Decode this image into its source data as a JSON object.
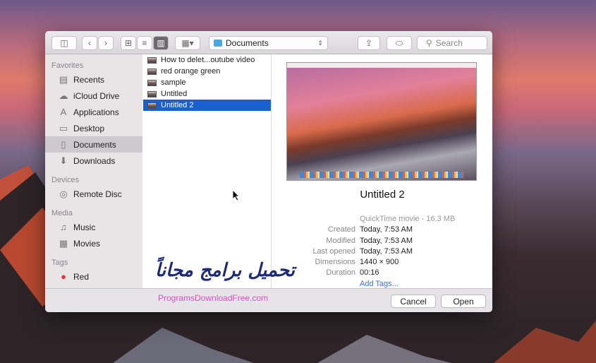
{
  "toolbar": {
    "location": "Documents",
    "search_placeholder": "Search"
  },
  "sidebar": {
    "sections": [
      {
        "title": "Favorites",
        "items": [
          {
            "label": "Recents",
            "icon": "recents-icon",
            "glyph": "▤"
          },
          {
            "label": "iCloud Drive",
            "icon": "cloud-icon",
            "glyph": "☁"
          },
          {
            "label": "Applications",
            "icon": "applications-icon",
            "glyph": "A"
          },
          {
            "label": "Desktop",
            "icon": "desktop-icon",
            "glyph": "▭"
          },
          {
            "label": "Documents",
            "icon": "documents-icon",
            "glyph": "▯",
            "selected": true
          },
          {
            "label": "Downloads",
            "icon": "downloads-icon",
            "glyph": "⬇"
          }
        ]
      },
      {
        "title": "Devices",
        "items": [
          {
            "label": "Remote Disc",
            "icon": "disc-icon",
            "glyph": "◎"
          }
        ]
      },
      {
        "title": "Media",
        "items": [
          {
            "label": "Music",
            "icon": "music-icon",
            "glyph": "♫"
          },
          {
            "label": "Movies",
            "icon": "movies-icon",
            "glyph": "▦"
          }
        ]
      },
      {
        "title": "Tags",
        "items": [
          {
            "label": "Red",
            "icon": "red-tag-icon",
            "glyph": "●",
            "color": "#e8323c"
          }
        ]
      }
    ]
  },
  "files": [
    {
      "name": "How to delet...outube video"
    },
    {
      "name": "red orange green"
    },
    {
      "name": "sample"
    },
    {
      "name": "Untitled"
    },
    {
      "name": "Untitled 2",
      "selected": true
    }
  ],
  "preview": {
    "title": "Untitled 2",
    "kind": "QuickTime movie - 16.3 MB",
    "meta": [
      {
        "k": "Created",
        "v": "Today, 7:53 AM"
      },
      {
        "k": "Modified",
        "v": "Today, 7:53 AM"
      },
      {
        "k": "Last opened",
        "v": "Today, 7:53 AM"
      },
      {
        "k": "Dimensions",
        "v": "1440 × 900"
      },
      {
        "k": "Duration",
        "v": "00:16"
      }
    ],
    "add_tags": "Add Tags..."
  },
  "buttons": {
    "cancel": "Cancel",
    "open": "Open"
  },
  "watermark": {
    "arabic": "تحميل برامج مجاناً",
    "site": "ProgramsDownloadFree.com"
  },
  "colors": {
    "selection": "#1a5fd0",
    "link": "#3a6fd8"
  }
}
